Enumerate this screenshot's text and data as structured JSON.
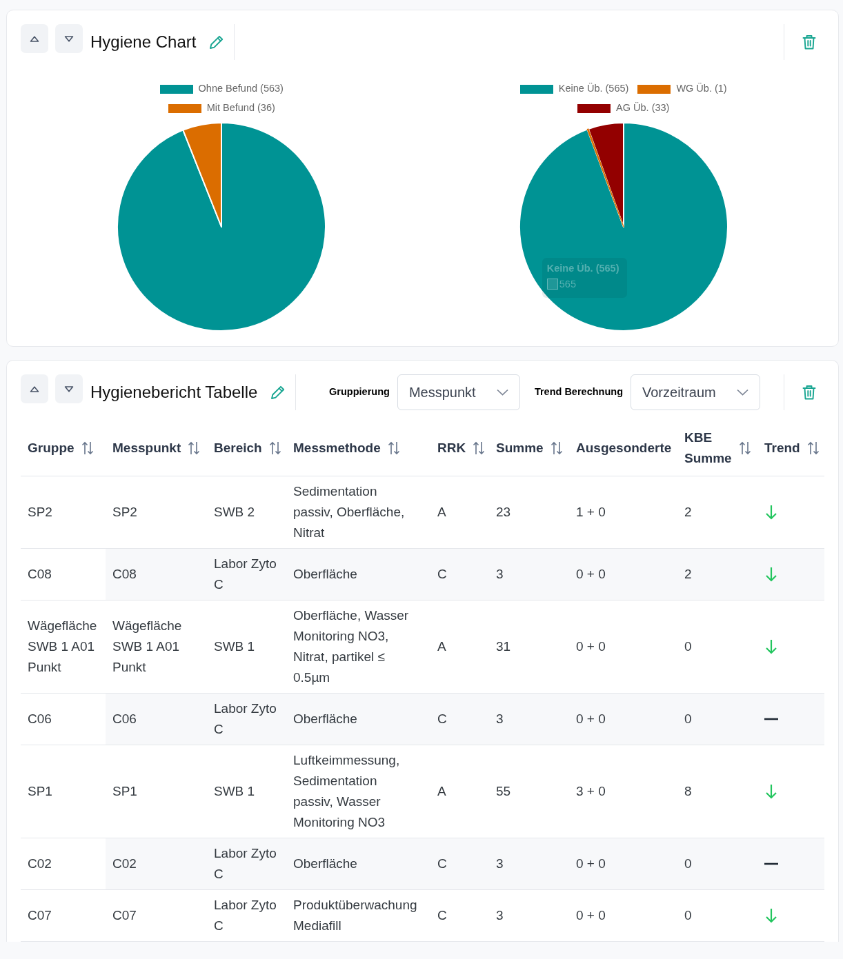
{
  "chart_panel": {
    "title": "Hygiene Chart",
    "charts": [
      {
        "chart_data": {
          "type": "pie",
          "categories": [
            "Ohne Befund (563)",
            "Mit Befund (36)"
          ],
          "values": [
            563,
            36
          ],
          "colors": [
            "#009394",
            "#db6d00"
          ],
          "legend": "top"
        }
      },
      {
        "chart_data": {
          "type": "pie",
          "categories": [
            "Keine Üb. (565)",
            "WG Üb. (1)",
            "AG Üb. (33)"
          ],
          "values": [
            565,
            1,
            33
          ],
          "colors": [
            "#009394",
            "#db6d00",
            "#930000"
          ],
          "legend": "top"
        },
        "tooltip": {
          "title": "Keine Üb. (565)",
          "value": "565"
        }
      }
    ]
  },
  "table_panel": {
    "title": "Hygienebericht Tabelle",
    "filters": [
      {
        "label": "Gruppierung",
        "value": "Messpunkt"
      },
      {
        "label": "Trend Berechnung",
        "value": "Vorzeitraum"
      }
    ],
    "table": {
      "columns": [
        {
          "label": "Gruppe",
          "sortable": true
        },
        {
          "label": "Messpunkt",
          "sortable": true
        },
        {
          "label": "Bereich",
          "sortable": true
        },
        {
          "label": "Messmethode",
          "sortable": true
        },
        {
          "label": "RRK",
          "sortable": true
        },
        {
          "label": "Summe",
          "sortable": true
        },
        {
          "label": "Ausgesonderte",
          "sortable": false
        },
        {
          "label": "KBE Summe",
          "sortable": true
        },
        {
          "label": "Trend",
          "sortable": true
        }
      ],
      "rows": [
        {
          "cells": [
            "SP2",
            "SP2",
            "SWB 2",
            "Sedimentation passiv, Oberfläche, Nitrat",
            "A",
            "23",
            "1 + 0",
            "2"
          ],
          "trend": {
            "kind": "down"
          }
        },
        {
          "cells": [
            "C08",
            "C08",
            "Labor Zyto C",
            "Oberfläche",
            "C",
            "3",
            "0 + 0",
            "2"
          ],
          "trend": {
            "kind": "down"
          }
        },
        {
          "cells": [
            "Wägefläche SWB 1 A01 Punkt",
            "Wägefläche SWB 1 A01 Punkt",
            "SWB 1",
            "Oberfläche, Wasser Monitoring NO3, Nitrat, partikel ≤ 0.5µm",
            "A",
            "31",
            "0 + 0",
            "0"
          ],
          "trend": {
            "kind": "down"
          }
        },
        {
          "cells": [
            "C06",
            "C06",
            "Labor Zyto C",
            "Oberfläche",
            "C",
            "3",
            "0 + 0",
            "0"
          ],
          "trend": {
            "kind": "flat"
          }
        },
        {
          "cells": [
            "SP1",
            "SP1",
            "SWB 1",
            "Luftkeimmessung, Sedimentation passiv, Wasser Monitoring NO3",
            "A",
            "55",
            "3 + 0",
            "8"
          ],
          "trend": {
            "kind": "down"
          }
        },
        {
          "cells": [
            "C02",
            "C02",
            "Labor Zyto C",
            "Oberfläche",
            "C",
            "3",
            "0 + 0",
            "0"
          ],
          "trend": {
            "kind": "flat"
          }
        },
        {
          "cells": [
            "C07",
            "C07",
            "Labor Zyto C",
            "Produktüberwachung Mediafill",
            "C",
            "3",
            "0 + 0",
            "0"
          ],
          "trend": {
            "kind": "down"
          }
        }
      ]
    }
  }
}
